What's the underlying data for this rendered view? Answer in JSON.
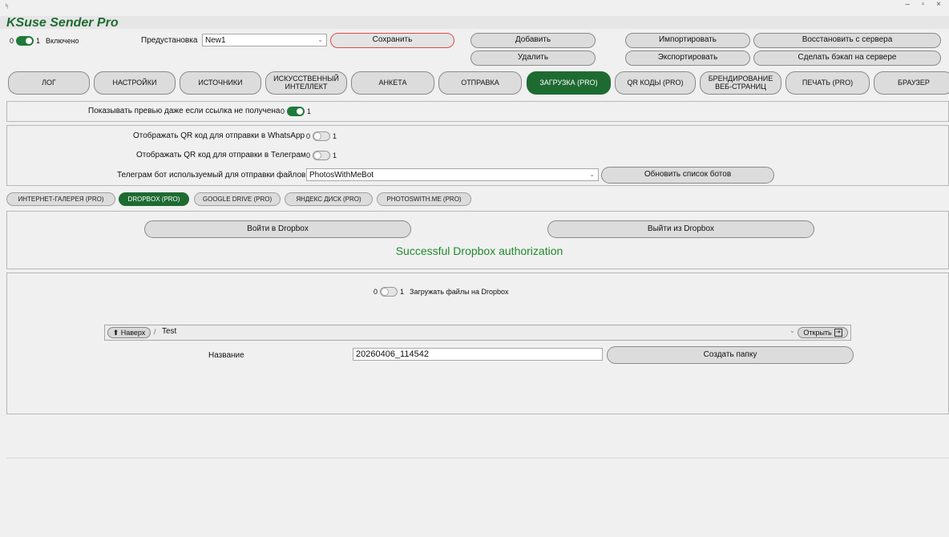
{
  "window": {
    "app_glyph": "ᛋ",
    "controls": "–  ▫  ×",
    "title": "KSuse Sender Pro"
  },
  "topbar": {
    "enabled_toggle": {
      "off": "0",
      "on": "1",
      "label": "Включено",
      "state": "on"
    },
    "preset_label": "Предустановка",
    "preset_value": "New1",
    "save": "Сохранить",
    "add": "Добавить",
    "delete": "Удалить",
    "import": "Импортировать",
    "export": "Экспортировать",
    "restore": "Восстановить с сервера",
    "backup": "Сделать бэкап на сервере"
  },
  "tabs": [
    {
      "label": "ЛОГ",
      "active": false
    },
    {
      "label": "НАСТРОЙКИ",
      "active": false
    },
    {
      "label": "ИСТОЧНИКИ",
      "active": false
    },
    {
      "label": "ИСКУССТВЕННЫЙ ИНТЕЛЛЕКТ",
      "active": false
    },
    {
      "label": "АНКЕТА",
      "active": false
    },
    {
      "label": "ОТПРАВКА",
      "active": false
    },
    {
      "label": "ЗАГРУЗКА (PRO)",
      "active": true
    },
    {
      "label": "QR КОДЫ (PRO)",
      "active": false
    },
    {
      "label": "БРЕНДИРОВАНИЕ ВЕБ-СТРАНИЦ",
      "active": false
    },
    {
      "label": "ПЕЧАТЬ (PRO)",
      "active": false
    },
    {
      "label": "БРАУЗЕР",
      "active": false
    }
  ],
  "preview": {
    "label": "Показывать превью даже если ссылка не получена",
    "off": "0",
    "on": "1",
    "state": "on"
  },
  "qr": {
    "whatsapp_label": "Отображать QR код для отправки в WhatsApp",
    "telegram_label": "Отображать QR код для отправки в Телеграм",
    "off": "0",
    "on": "1",
    "bot_label": "Телеграм бот используемый для отправки файлов",
    "bot_value": "PhotosWithMeBot",
    "refresh_bots": "Обновить список ботов"
  },
  "subtabs": [
    {
      "label": "ИНТЕРНЕТ-ГАЛЕРЕЯ (PRO)",
      "active": false
    },
    {
      "label": "DROPBOX (PRO)",
      "active": true
    },
    {
      "label": "GOOGLE DRIVE (PRO)",
      "active": false
    },
    {
      "label": "ЯНДЕКС ДИСК (PRO)",
      "active": false
    },
    {
      "label": "PHOTOSWITH.ME (PRO)",
      "active": false
    }
  ],
  "dropbox": {
    "login": "Войти в Dropbox",
    "logout": "Выйти из Dropbox",
    "status": "Successful Dropbox authorization",
    "upload_toggle": {
      "off": "0",
      "on": "1",
      "label": "Загружать файлы на Dropbox",
      "state": "off"
    },
    "up_button": "⬆ Наверх",
    "path_sep": "/",
    "path": "Test",
    "open_button": "Открыть",
    "name_label": "Название",
    "name_value": "20260406_114542",
    "create_folder": "Создать папку"
  },
  "colors": {
    "accent": "#1e6b32",
    "success": "#1f8a2e",
    "save_border": "#d94b4b"
  }
}
